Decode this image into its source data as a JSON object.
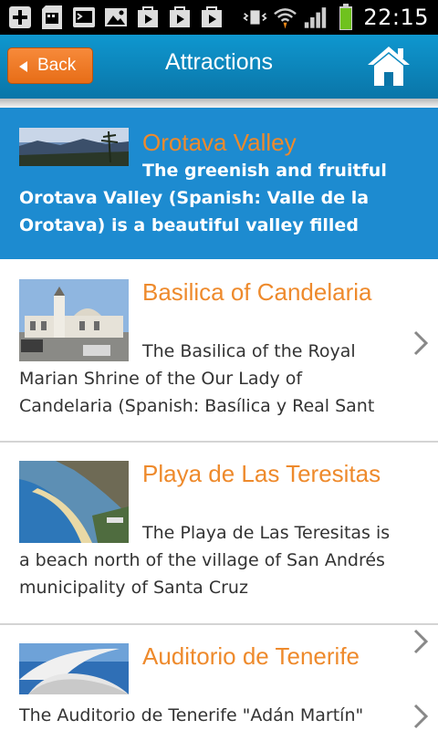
{
  "status_bar": {
    "time": "22:15",
    "icons": [
      "add-icon",
      "sd-card-icon",
      "terminal-icon",
      "picture-icon",
      "play-store-icon",
      "play-store-icon",
      "play-store-icon",
      "vibrate-icon",
      "wifi-icon",
      "signal-icon",
      "battery-icon"
    ]
  },
  "header": {
    "back_label": "Back",
    "title": "Attractions",
    "home_icon": "home-icon"
  },
  "attractions": [
    {
      "title": "Orotava Valley",
      "description": "The greenish and fruitful Orotava Valley (Spanish: Valle de la Orotava) is a beautiful valley filled",
      "selected": true
    },
    {
      "title": "Basilica of Candelaria",
      "description": "The Basilica of the Royal Marian Shrine of the Our Lady of Candelaria (Spanish: Basílica y Real Sant",
      "selected": false
    },
    {
      "title": "Playa de Las Teresitas",
      "description": "The Playa de Las Teresitas is a beach north of the village of San Andrés municipality of Santa Cruz",
      "selected": false
    },
    {
      "title": "Auditorio de Tenerife",
      "description": "The Auditorio de Tenerife \"Adán Martín\"",
      "selected": false
    }
  ],
  "colors": {
    "header_blue": "#0a75a8",
    "selected_blue": "#1d8bd0",
    "title_orange": "#ee8a2c",
    "back_orange": "#e76d17"
  }
}
